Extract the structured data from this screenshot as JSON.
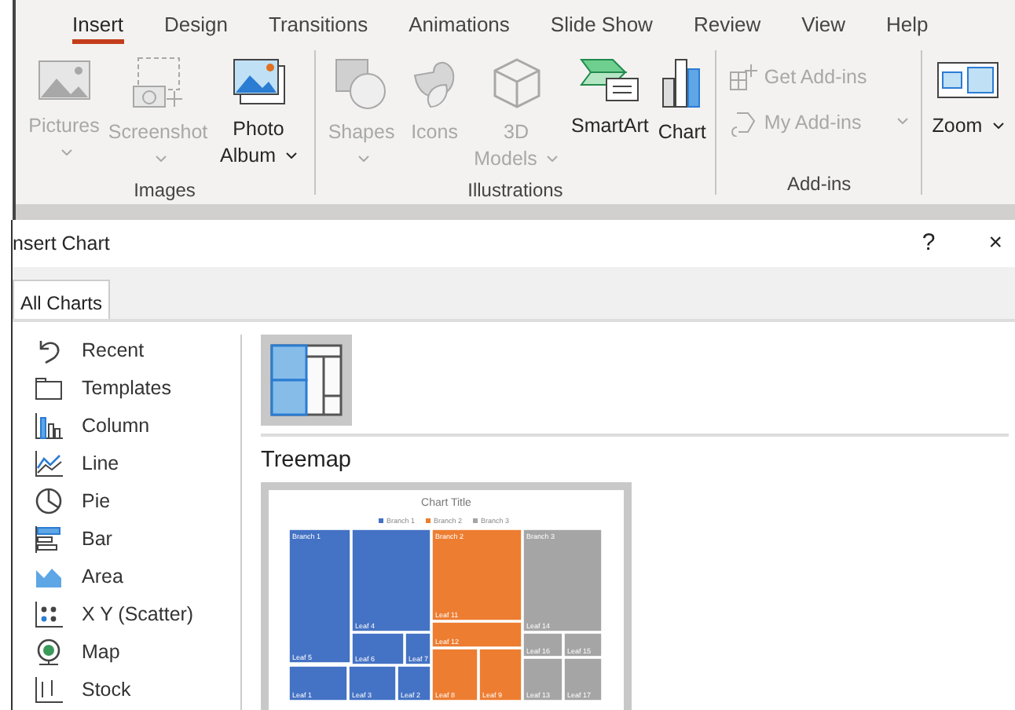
{
  "ribbon": {
    "tabs": [
      {
        "label": "Insert",
        "selected": true
      },
      {
        "label": "Design",
        "selected": false
      },
      {
        "label": "Transitions",
        "selected": false
      },
      {
        "label": "Animations",
        "selected": false
      },
      {
        "label": "Slide Show",
        "selected": false
      },
      {
        "label": "Review",
        "selected": false
      },
      {
        "label": "View",
        "selected": false
      },
      {
        "label": "Help",
        "selected": false
      }
    ],
    "groups": [
      {
        "label": "Images",
        "buttons": [
          {
            "kind": "large",
            "label": "Pictures",
            "disabled": true,
            "dropdown": true
          },
          {
            "kind": "large",
            "label": "Screenshot",
            "disabled": true,
            "dropdown": true
          },
          {
            "kind": "large",
            "label": "Photo Album",
            "disabled": false,
            "dropdown": true
          }
        ]
      },
      {
        "label": "Illustrations",
        "buttons": [
          {
            "kind": "large",
            "label": "Shapes",
            "disabled": true,
            "dropdown": true
          },
          {
            "kind": "large",
            "label": "Icons",
            "disabled": true,
            "dropdown": false
          },
          {
            "kind": "large",
            "label": "3D Models",
            "disabled": true,
            "dropdown": true
          },
          {
            "kind": "large",
            "label": "SmartArt",
            "disabled": false,
            "dropdown": false
          },
          {
            "kind": "large",
            "label": "Chart",
            "disabled": false,
            "dropdown": false
          }
        ]
      },
      {
        "label": "Add-ins",
        "buttons": [
          {
            "kind": "small",
            "label": "Get Add-ins",
            "disabled": true,
            "dropdown": false
          },
          {
            "kind": "small",
            "label": "My Add-ins",
            "disabled": true,
            "dropdown": true
          }
        ]
      },
      {
        "buttons": [
          {
            "kind": "large",
            "label": "Zoom",
            "disabled": false,
            "dropdown": true
          }
        ]
      }
    ]
  },
  "dialog": {
    "title": "nsert Chart",
    "help": "?",
    "close": "×",
    "tabs": [
      {
        "label": "All Charts",
        "selected": true
      }
    ],
    "categories": [
      {
        "label": "Recent"
      },
      {
        "label": "Templates"
      },
      {
        "label": "Column"
      },
      {
        "label": "Line"
      },
      {
        "label": "Pie"
      },
      {
        "label": "Bar"
      },
      {
        "label": "Area"
      },
      {
        "label": "X Y (Scatter)"
      },
      {
        "label": "Map"
      },
      {
        "label": "Stock"
      }
    ],
    "subtypes": [
      {
        "selected": true
      }
    ],
    "type_title": "Treemap",
    "preview": {
      "title": "Chart Title",
      "legend": [
        {
          "label": "Branch 1",
          "color": "#4472c4"
        },
        {
          "label": "Branch 2",
          "color": "#ed7d31"
        },
        {
          "label": "Branch 3",
          "color": "#a5a5a5"
        }
      ],
      "tiles": [
        {
          "top_label": "Branch 1",
          "label": "Leaf 5",
          "color": "#4472c4"
        },
        {
          "label": "Leaf 4",
          "color": "#4472c4"
        },
        {
          "label": "Leaf 6",
          "color": "#4472c4"
        },
        {
          "label": "Leaf 7",
          "color": "#4472c4"
        },
        {
          "label": "Leaf 1",
          "color": "#4472c4"
        },
        {
          "label": "Leaf 3",
          "color": "#4472c4"
        },
        {
          "label": "Leaf 2",
          "color": "#4472c4"
        },
        {
          "top_label": "Branch 2",
          "label": "Leaf 11",
          "color": "#ed7d31"
        },
        {
          "label": "Leaf 12",
          "color": "#ed7d31"
        },
        {
          "label": "Leaf 8",
          "color": "#ed7d31"
        },
        {
          "label": "Leaf 9",
          "color": "#ed7d31"
        },
        {
          "top_label": "Branch 3",
          "label": "Leaf 14",
          "color": "#a5a5a5"
        },
        {
          "label": "Leaf 16",
          "color": "#a5a5a5"
        },
        {
          "label": "Leaf 15",
          "color": "#a5a5a5"
        },
        {
          "label": "Leaf 13",
          "color": "#a5a5a5"
        },
        {
          "label": "Leaf 17",
          "color": "#a5a5a5"
        }
      ]
    }
  }
}
